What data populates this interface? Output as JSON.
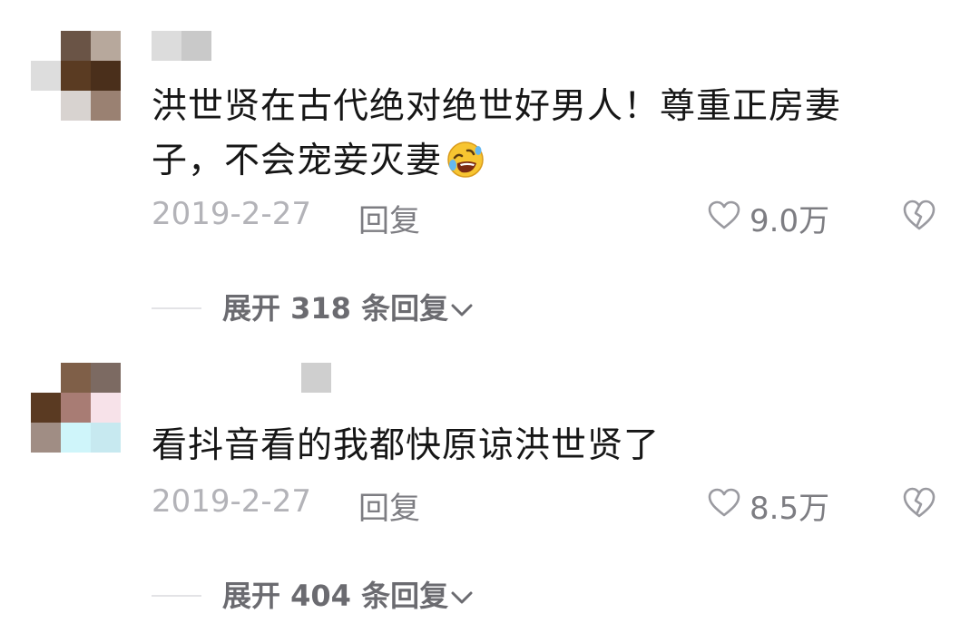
{
  "comments": [
    {
      "text_line1": "洪世贤在古代绝对绝世好男人！尊重正房妻",
      "text_line2": "子，不会宠妾灭妻",
      "date": "2019-2-27",
      "reply_label": "回复",
      "like_count": "9.0万",
      "expand_label": "展开 318 条回复",
      "emoji": "rolling-on-floor-laughing-emoji"
    },
    {
      "text_line1": "看抖音看的我都快原谅洪世贤了",
      "date": "2019-2-27",
      "reply_label": "回复",
      "like_count": "8.5万",
      "expand_label": "展开 404 条回复"
    }
  ],
  "colors": {
    "text": "#161616",
    "meta": "#7d7d82",
    "date": "#b3b3b8",
    "expand": "#6b6b70"
  },
  "icons": [
    "heart-outline-icon",
    "broken-heart-icon",
    "chevron-down-icon"
  ]
}
